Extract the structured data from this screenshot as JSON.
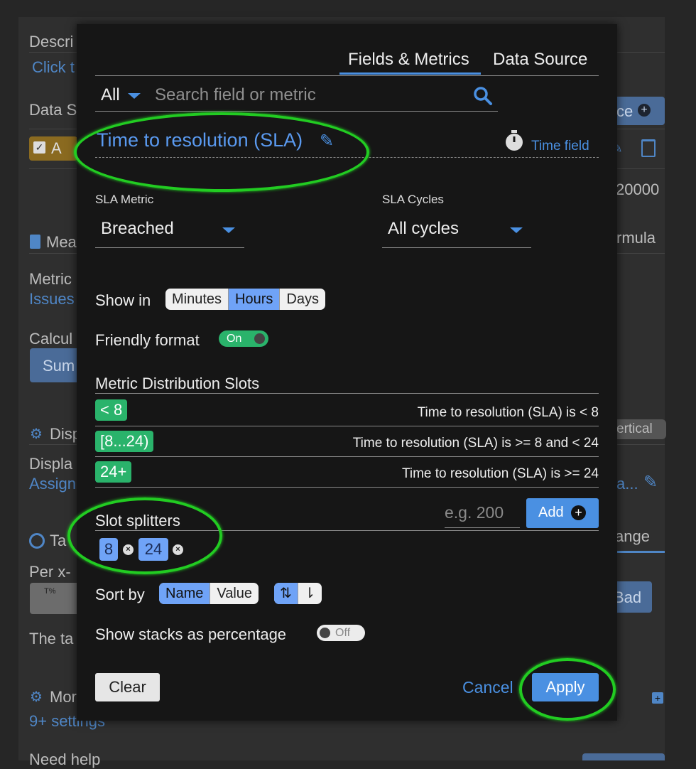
{
  "background": {
    "desc_label": "Descri",
    "click_link": "Click t",
    "data_label": "Data S",
    "source_btn": "ce",
    "check_label": "A",
    "value_text": "20000",
    "meas_label": "Mea",
    "formula_text": "rmula",
    "metric_label": "Metric",
    "issues_link": "Issues",
    "calc_label": "Calcul",
    "sum_btn": "Sum",
    "disp_label": "Disp",
    "vertical_badge": "ertical",
    "display_label": "Displa",
    "assign_link": "Assign",
    "ellipsis": "a...",
    "target_label": "Ta",
    "range_tab": "ange",
    "per_label": "Per x-",
    "bad_btn": "Bad",
    "the_label": "The ta",
    "more_label": "Mor",
    "settings_link": "9+ settings",
    "help_label": "Need help"
  },
  "modal": {
    "tabs": [
      {
        "label": "Fields & Metrics",
        "active": true
      },
      {
        "label": "Data Source",
        "active": false
      }
    ],
    "search": {
      "filter_value": "All",
      "placeholder": "Search field or metric"
    },
    "field_title": "Time to resolution (SLA)",
    "time_field_link": "Time field",
    "sla_metric": {
      "label": "SLA Metric",
      "value": "Breached"
    },
    "sla_cycles": {
      "label": "SLA Cycles",
      "value": "All cycles"
    },
    "show_in": {
      "label": "Show in",
      "options": [
        "Minutes",
        "Hours",
        "Days"
      ],
      "selected": "Hours"
    },
    "friendly_format": {
      "label": "Friendly format",
      "state": "On"
    },
    "distribution": {
      "title": "Metric Distribution Slots",
      "slots": [
        {
          "badge": "< 8",
          "desc": "Time to resolution (SLA) is < 8"
        },
        {
          "badge": "[8...24)",
          "desc": "Time to resolution (SLA) is >= 8 and < 24"
        },
        {
          "badge": "24+",
          "desc": "Time to resolution (SLA) is >= 24"
        }
      ]
    },
    "splitters": {
      "title": "Slot splitters",
      "placeholder": "e.g. 200",
      "add_label": "Add",
      "values": [
        "8",
        "24"
      ]
    },
    "sort_by": {
      "label": "Sort by",
      "options": [
        "Name",
        "Value"
      ],
      "selected": "Name"
    },
    "stacks": {
      "label": "Show stacks as percentage",
      "state": "Off"
    },
    "buttons": {
      "clear": "Clear",
      "cancel": "Cancel",
      "apply": "Apply"
    }
  },
  "colors": {
    "accent": "#6fa3f7",
    "link": "#4a90e2",
    "slot_green": "#2ab36b",
    "highlight_ring": "#22cc22"
  }
}
